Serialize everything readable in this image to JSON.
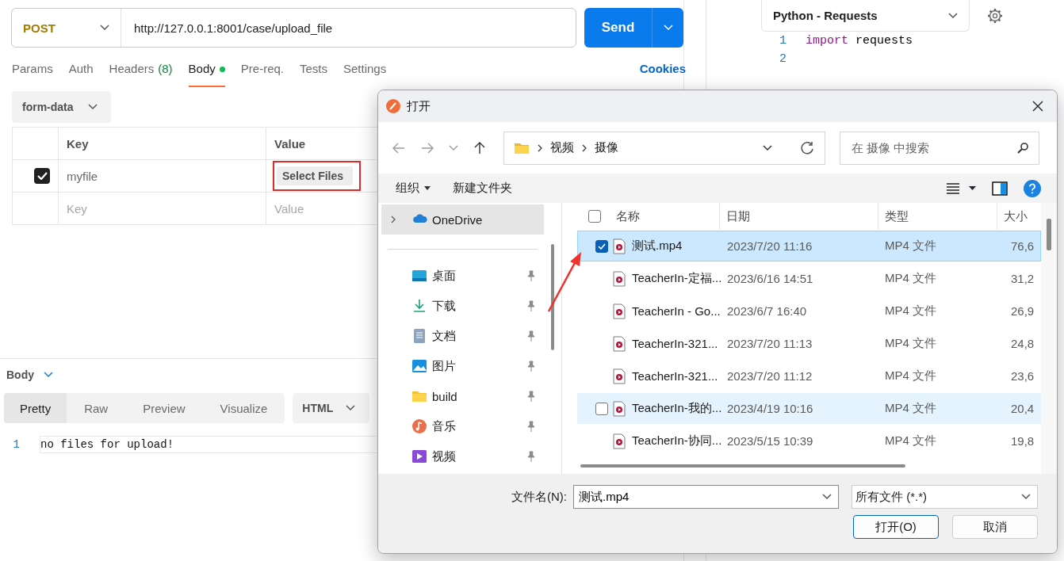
{
  "request": {
    "method": "POST",
    "url": "http://127.0.0.1:8001/case/upload_file",
    "send": "Send"
  },
  "request_tabs": [
    {
      "label": "Params",
      "selected": false
    },
    {
      "label": "Auth",
      "selected": false
    },
    {
      "label": "Headers",
      "count": "(8)",
      "selected": false
    },
    {
      "label": "Body",
      "dot": true,
      "selected": true
    },
    {
      "label": "Pre-req.",
      "selected": false
    },
    {
      "label": "Tests",
      "selected": false
    },
    {
      "label": "Settings",
      "selected": false
    }
  ],
  "cookies": "Cookies",
  "body_mode": "form-data",
  "form_table": {
    "columns": [
      "Key",
      "Value"
    ],
    "rows": [
      {
        "checked": true,
        "key": "myfile",
        "value_button": "Select Files",
        "highlighted": true
      }
    ],
    "placeholder_row": {
      "key": "Key",
      "value": "Value"
    }
  },
  "response": {
    "title": "Body",
    "view_tabs": [
      {
        "label": "Pretty",
        "selected": true
      },
      {
        "label": "Raw",
        "selected": false
      },
      {
        "label": "Preview",
        "selected": false
      },
      {
        "label": "Visualize",
        "selected": false
      }
    ],
    "format": "HTML",
    "lines": [
      {
        "number": "1",
        "text": "no files for upload!"
      }
    ]
  },
  "code_panel": {
    "language": "Python - Requests",
    "lines": [
      {
        "number": "1",
        "tokens": [
          {
            "text": "import",
            "kind": "keyword"
          },
          {
            "text": "requests",
            "kind": "plain"
          }
        ]
      },
      {
        "number": "2"
      }
    ]
  },
  "dialog": {
    "title": "打开",
    "breadcrumb": [
      "视频",
      "摄像"
    ],
    "search": {
      "placeholder": "在 摄像 中搜索"
    },
    "toolbar": [
      {
        "label": "组织",
        "menu": true
      },
      {
        "label": "新建文件夹",
        "menu": false
      }
    ],
    "nav": [
      {
        "label": "OneDrive",
        "kind": "cloud",
        "selected": true,
        "pinned": false
      },
      {
        "label": "桌面",
        "kind": "desktop",
        "selected": false,
        "pinned": true
      },
      {
        "label": "下载",
        "kind": "download",
        "selected": false,
        "pinned": true
      },
      {
        "label": "文档",
        "kind": "document",
        "selected": false,
        "pinned": true
      },
      {
        "label": "图片",
        "kind": "picture",
        "selected": false,
        "pinned": true
      },
      {
        "label": "build",
        "kind": "folder",
        "selected": false,
        "pinned": true
      },
      {
        "label": "音乐",
        "kind": "music",
        "selected": false,
        "pinned": true
      },
      {
        "label": "视频",
        "kind": "video",
        "selected": false,
        "pinned": true
      }
    ],
    "columns": [
      "名称",
      "日期",
      "类型",
      "大小"
    ],
    "select_all_checked": false,
    "files": [
      {
        "name": "测试.mp4",
        "date": "2023/7/20 11:16",
        "type": "MP4 文件",
        "size": "76,6",
        "selected": true,
        "checked": true,
        "hovered": false
      },
      {
        "name": "TeacherIn-定福...",
        "date": "2023/6/16 14:51",
        "type": "MP4 文件",
        "size": "31,2",
        "selected": false,
        "checked": false,
        "hovered": false
      },
      {
        "name": "TeacherIn - Go...",
        "date": "2023/6/7 16:40",
        "type": "MP4 文件",
        "size": "26,9",
        "selected": false,
        "checked": false,
        "hovered": false
      },
      {
        "name": "TeacherIn-321...",
        "date": "2023/7/20 11:13",
        "type": "MP4 文件",
        "size": "24,8",
        "selected": false,
        "checked": false,
        "hovered": false
      },
      {
        "name": "TeacherIn-321...",
        "date": "2023/7/20 11:12",
        "type": "MP4 文件",
        "size": "23,6",
        "selected": false,
        "checked": false,
        "hovered": false
      },
      {
        "name": "TeacherIn-我的...",
        "date": "2023/4/19 10:16",
        "type": "MP4 文件",
        "size": "20,4",
        "selected": false,
        "checked": false,
        "hovered": true
      },
      {
        "name": "TeacherIn-协同...",
        "date": "2023/5/15 10:39",
        "type": "MP4 文件",
        "size": "19,8",
        "selected": false,
        "checked": false,
        "hovered": false
      }
    ],
    "filename": {
      "label": "文件名(N):",
      "value": "测试.mp4"
    },
    "filter": "所有文件 (*.*)",
    "buttons": [
      {
        "label": "打开(O)",
        "primary": true
      },
      {
        "label": "取消",
        "primary": false
      }
    ]
  }
}
